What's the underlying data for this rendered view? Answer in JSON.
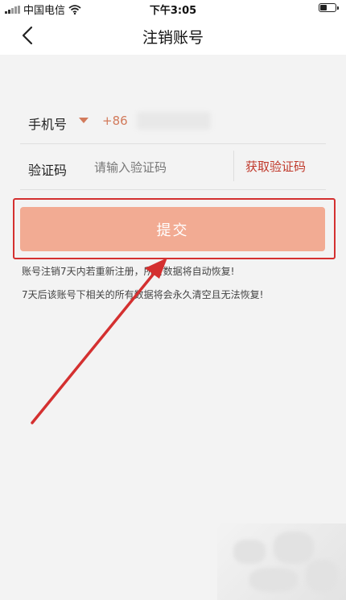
{
  "status_bar": {
    "carrier": "中国电信",
    "time": "下午3:05"
  },
  "nav": {
    "title": "注销账号",
    "back_icon": "chevron-left-icon"
  },
  "form": {
    "phone_label": "手机号",
    "country_code": "+86",
    "code_label": "验证码",
    "code_placeholder": "请输入验证码",
    "get_code": "获取验证码"
  },
  "submit": {
    "label": "提交"
  },
  "notices": [
    "账号注销7天内若重新注册，所有数据将自动恢复!",
    "7天后该账号下相关的所有数据将会永久清空且无法恢复!"
  ],
  "colors": {
    "accent": "#d27a5b",
    "button": "#f2ab93",
    "get_code": "#c0392b",
    "highlight": "#d43030",
    "arrow": "#d43030"
  }
}
